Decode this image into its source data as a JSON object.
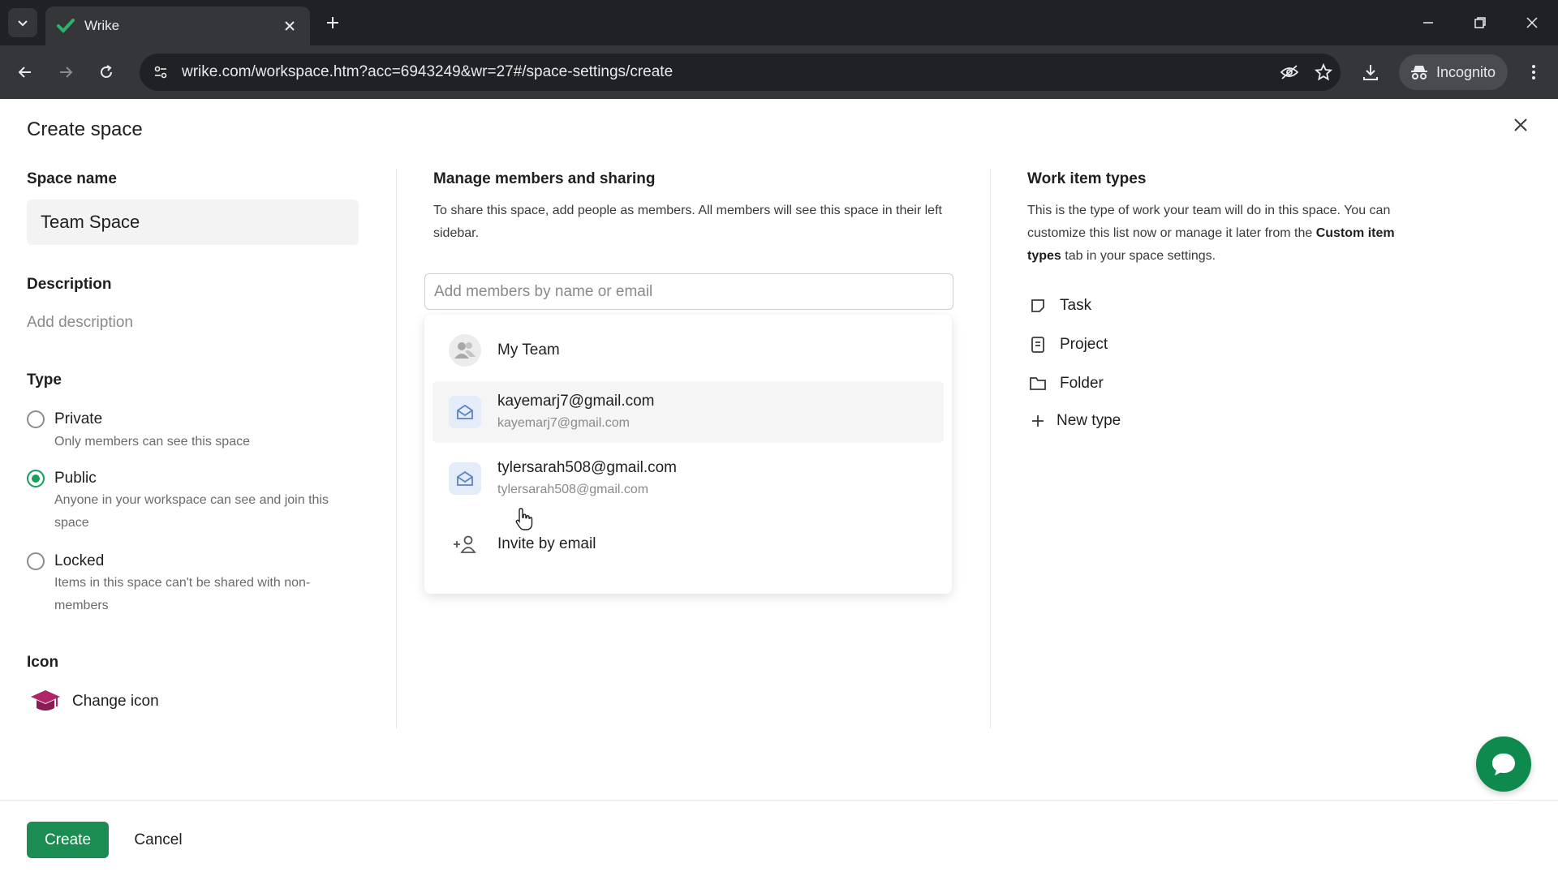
{
  "browser": {
    "tab_title": "Wrike",
    "url": "wrike.com/workspace.htm?acc=6943249&wr=27#/space-settings/create",
    "incognito_label": "Incognito"
  },
  "dialog": {
    "title": "Create space"
  },
  "left": {
    "space_name_label": "Space name",
    "space_name_value": "Team Space",
    "description_label": "Description",
    "description_placeholder": "Add description",
    "type_label": "Type",
    "types": [
      {
        "label": "Private",
        "desc": "Only members can see this space",
        "checked": false
      },
      {
        "label": "Public",
        "desc": "Anyone in your workspace can see and join this space",
        "checked": true
      },
      {
        "label": "Locked",
        "desc": "Items in this space can't be shared with non-members",
        "checked": false
      }
    ],
    "icon_label": "Icon",
    "change_icon_label": "Change icon"
  },
  "members": {
    "heading": "Manage members and sharing",
    "description": "To share this space, add people as members. All members will see this space in their left sidebar.",
    "input_placeholder": "Add members by name or email",
    "suggestions": [
      {
        "name": "My Team",
        "email": ""
      },
      {
        "name": "kayemarj7@gmail.com",
        "email": "kayemarj7@gmail.com"
      },
      {
        "name": "tylersarah508@gmail.com",
        "email": "tylersarah508@gmail.com"
      }
    ],
    "invite_label": "Invite by email"
  },
  "work_items": {
    "heading": "Work item types",
    "desc_part1": "This is the type of work your team will do in this space. You can customize this list now or manage it later from the ",
    "desc_bold": "Custom item types",
    "desc_part2": " tab in your space settings.",
    "items": [
      "Task",
      "Project",
      "Folder"
    ],
    "new_type_label": "New type"
  },
  "footer": {
    "create_label": "Create",
    "cancel_label": "Cancel"
  },
  "colors": {
    "accent_green": "#1b8c52",
    "chat_green": "#0f8a4f",
    "icon_magenta": "#b0246a"
  }
}
